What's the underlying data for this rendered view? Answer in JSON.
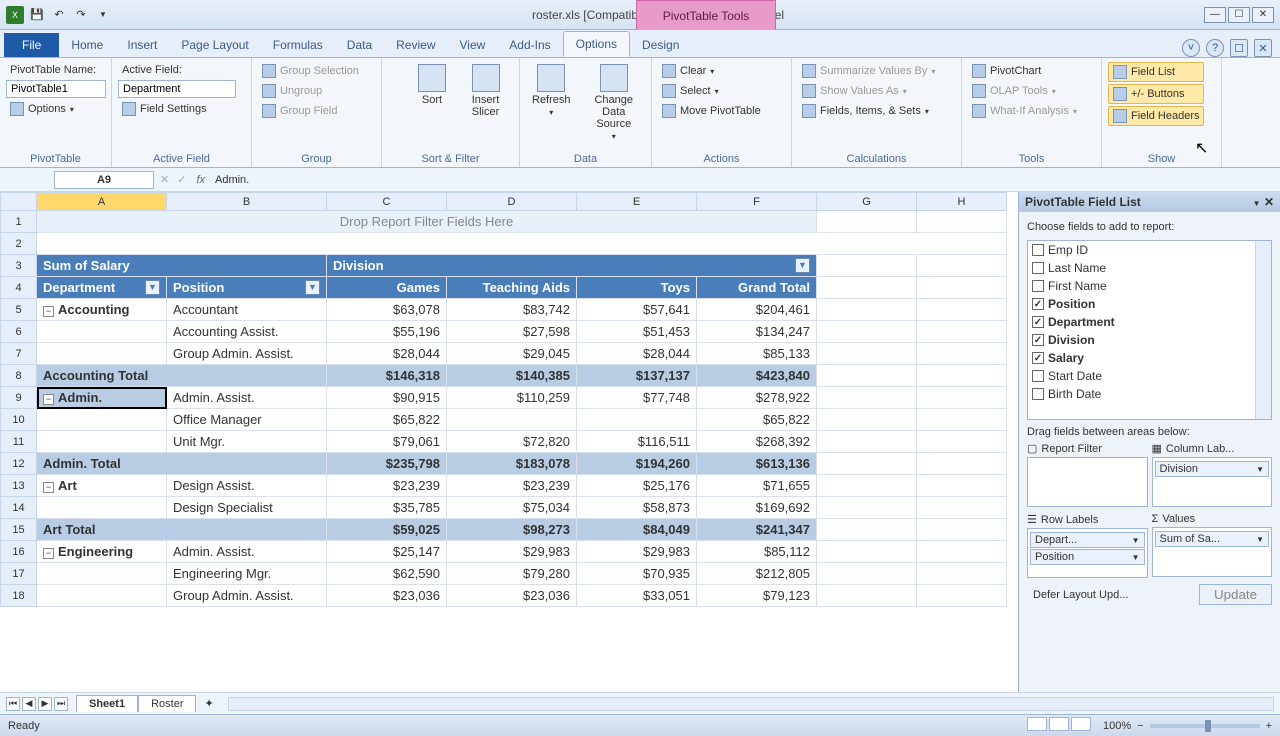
{
  "window": {
    "title": "roster.xls  [Compatibility Mode] - Microsoft Excel",
    "contextual_title": "PivotTable Tools"
  },
  "tabs": [
    "File",
    "Home",
    "Insert",
    "Page Layout",
    "Formulas",
    "Data",
    "Review",
    "View",
    "Add-Ins",
    "Options",
    "Design"
  ],
  "active_tab": "Options",
  "ribbon": {
    "pivottable": {
      "name_label": "PivotTable Name:",
      "name_value": "PivotTable1",
      "options": "Options",
      "group_label": "PivotTable"
    },
    "active_field": {
      "label": "Active Field:",
      "value": "Department",
      "field_settings": "Field Settings",
      "group_label": "Active Field"
    },
    "group": {
      "selection": "Group Selection",
      "ungroup": "Ungroup",
      "field": "Group Field",
      "group_label": "Group"
    },
    "sortfilter": {
      "sort": "Sort",
      "slicer": "Insert Slicer",
      "group_label": "Sort & Filter"
    },
    "data": {
      "refresh": "Refresh",
      "change_src": "Change Data Source",
      "group_label": "Data"
    },
    "actions": {
      "clear": "Clear",
      "select": "Select",
      "move": "Move PivotTable",
      "group_label": "Actions"
    },
    "calc": {
      "summarize": "Summarize Values By",
      "show_as": "Show Values As",
      "fields": "Fields, Items, & Sets",
      "group_label": "Calculations"
    },
    "tools": {
      "chart": "PivotChart",
      "olap": "OLAP Tools",
      "whatif": "What-If Analysis",
      "group_label": "Tools"
    },
    "show": {
      "field_list": "Field List",
      "buttons": "+/- Buttons",
      "headers": "Field Headers",
      "group_label": "Show"
    }
  },
  "formula": {
    "cell": "A9",
    "value": "Admin."
  },
  "columns": [
    "A",
    "B",
    "C",
    "D",
    "E",
    "F",
    "G",
    "H"
  ],
  "pivot": {
    "drop_hint": "Drop Report Filter Fields Here",
    "measure": "Sum of Salary",
    "col_field": "Division",
    "row_fields": [
      "Department",
      "Position"
    ],
    "col_headers": [
      "Games",
      "Teaching Aids",
      "Toys",
      "Grand Total"
    ],
    "rows": [
      {
        "r": 5,
        "dept": "Accounting",
        "pos": "Accountant",
        "vals": [
          "$63,078",
          "$83,742",
          "$57,641",
          "$204,461"
        ]
      },
      {
        "r": 6,
        "dept": "",
        "pos": "Accounting Assist.",
        "vals": [
          "$55,196",
          "$27,598",
          "$51,453",
          "$134,247"
        ]
      },
      {
        "r": 7,
        "dept": "",
        "pos": "Group Admin. Assist.",
        "vals": [
          "$28,044",
          "$29,045",
          "$28,044",
          "$85,133"
        ]
      },
      {
        "r": 8,
        "total": "Accounting Total",
        "vals": [
          "$146,318",
          "$140,385",
          "$137,137",
          "$423,840"
        ]
      },
      {
        "r": 9,
        "dept": "Admin.",
        "pos": "Admin. Assist.",
        "vals": [
          "$90,915",
          "$110,259",
          "$77,748",
          "$278,922"
        ],
        "sel": true
      },
      {
        "r": 10,
        "dept": "",
        "pos": "Office Manager",
        "vals": [
          "$65,822",
          "",
          "",
          "$65,822"
        ]
      },
      {
        "r": 11,
        "dept": "",
        "pos": "Unit Mgr.",
        "vals": [
          "$79,061",
          "$72,820",
          "$116,511",
          "$268,392"
        ]
      },
      {
        "r": 12,
        "total": "Admin. Total",
        "vals": [
          "$235,798",
          "$183,078",
          "$194,260",
          "$613,136"
        ]
      },
      {
        "r": 13,
        "dept": "Art",
        "pos": "Design Assist.",
        "vals": [
          "$23,239",
          "$23,239",
          "$25,176",
          "$71,655"
        ]
      },
      {
        "r": 14,
        "dept": "",
        "pos": "Design Specialist",
        "vals": [
          "$35,785",
          "$75,034",
          "$58,873",
          "$169,692"
        ]
      },
      {
        "r": 15,
        "total": "Art Total",
        "vals": [
          "$59,025",
          "$98,273",
          "$84,049",
          "$241,347"
        ]
      },
      {
        "r": 16,
        "dept": "Engineering",
        "pos": "Admin. Assist.",
        "vals": [
          "$25,147",
          "$29,983",
          "$29,983",
          "$85,112"
        ]
      },
      {
        "r": 17,
        "dept": "",
        "pos": "Engineering Mgr.",
        "vals": [
          "$62,590",
          "$79,280",
          "$70,935",
          "$212,805"
        ]
      },
      {
        "r": 18,
        "dept": "",
        "pos": "Group Admin. Assist.",
        "vals": [
          "$23,036",
          "$23,036",
          "$33,051",
          "$79,123"
        ]
      }
    ]
  },
  "fieldlist": {
    "title": "PivotTable Field List",
    "choose": "Choose fields to add to report:",
    "fields": [
      {
        "name": "Emp ID",
        "checked": false
      },
      {
        "name": "Last Name",
        "checked": false
      },
      {
        "name": "First Name",
        "checked": false
      },
      {
        "name": "Position",
        "checked": true
      },
      {
        "name": "Department",
        "checked": true
      },
      {
        "name": "Division",
        "checked": true
      },
      {
        "name": "Salary",
        "checked": true
      },
      {
        "name": "Start Date",
        "checked": false
      },
      {
        "name": "Birth Date",
        "checked": false
      }
    ],
    "drag_label": "Drag fields between areas below:",
    "areas": {
      "report_filter": {
        "label": "Report Filter",
        "items": []
      },
      "column": {
        "label": "Column Lab...",
        "items": [
          "Division"
        ]
      },
      "row": {
        "label": "Row Labels",
        "items": [
          "Depart...",
          "Position"
        ]
      },
      "values": {
        "label": "Values",
        "items": [
          "Sum of Sa..."
        ]
      }
    },
    "defer": "Defer Layout Upd...",
    "update": "Update"
  },
  "sheets": [
    "Sheet1",
    "Roster"
  ],
  "status": {
    "ready": "Ready",
    "zoom": "100%"
  }
}
